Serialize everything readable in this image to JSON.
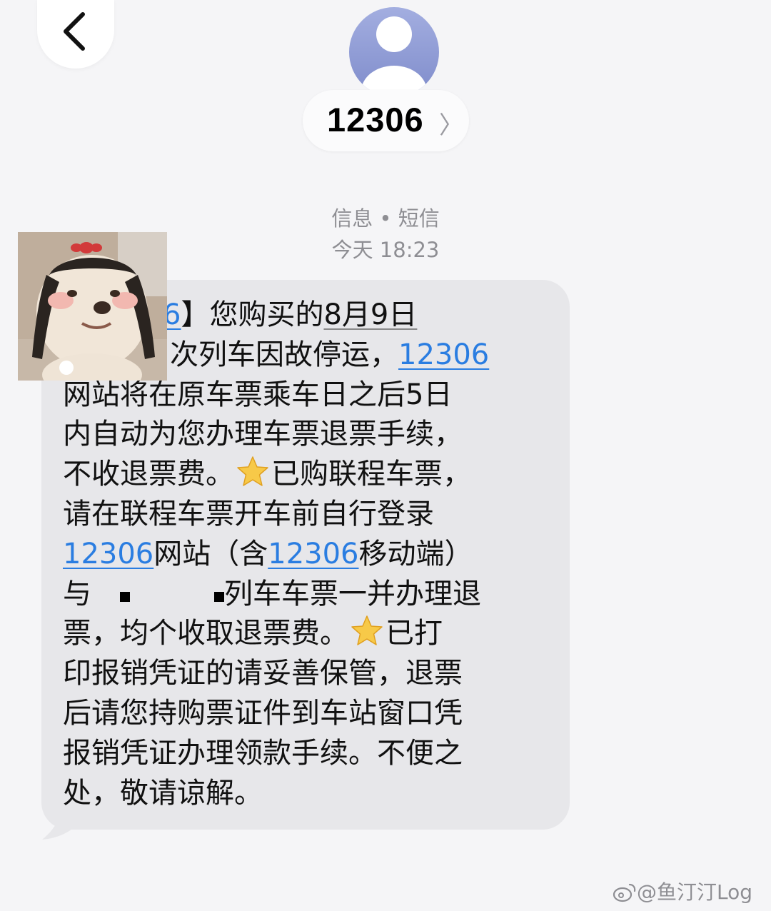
{
  "header": {
    "back_icon": "chevron-left-icon",
    "avatar_icon": "person-avatar-icon",
    "contact_name": "12306",
    "contact_chevron": "〉"
  },
  "meta": {
    "source": "信息 • 短信",
    "time": "今天 18:23"
  },
  "message": {
    "line1_bracket": "】您购买的",
    "line1_date": "8月9日",
    "line2_text": "次列车因故停运，",
    "link_number": "12306",
    "line3": "网站将在原车票乘车日之后5日",
    "line4": "内自动为您办理车票退票手续，",
    "line5_a": "不收退票费。",
    "line5_b": "已购联程车票，",
    "line6": "请在联程车票开车前自行登录",
    "line7_b": "网站（含",
    "line7_d": "移动端）",
    "line8_a": "与",
    "line8_b": "列车车票一并办理退",
    "line9_a": "票，均个收取退票费。",
    "line9_b": "已打",
    "line10": "印报销凭证的请妥善保管，退票",
    "line11": "后请您持购票证件到车站窗口凭",
    "line12": "报销凭证办理领款手续。不便之",
    "line13": "处，敬请谅解。",
    "star_icon": "star-emoji-icon"
  },
  "sticker": {
    "icon": "dog-sticker-image"
  },
  "watermark": {
    "text": "@鱼汀汀Log",
    "icon": "weibo-logo-icon"
  },
  "colors": {
    "link": "#2a7de1",
    "bubble": "#e7e7ea",
    "avatar": "#8e9bd6",
    "meta": "#8e8e93"
  }
}
